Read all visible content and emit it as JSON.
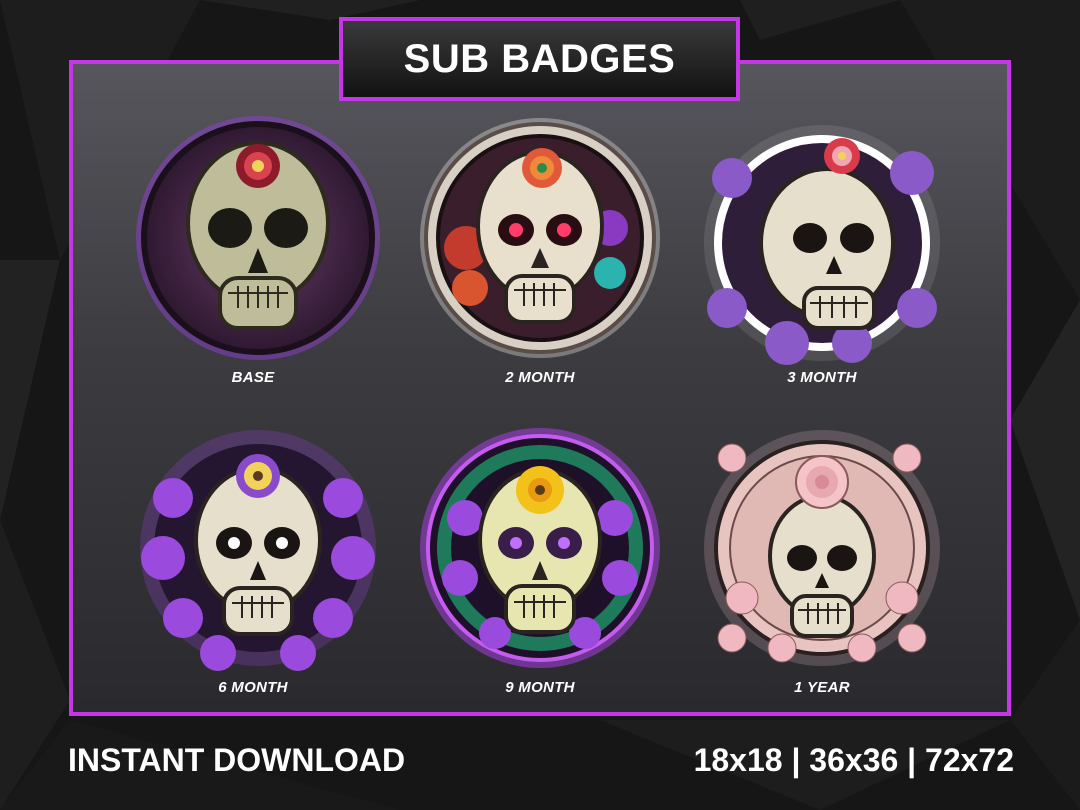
{
  "header": {
    "title": "SUB BADGES"
  },
  "badges": [
    {
      "label": "BASE"
    },
    {
      "label": "2 MONTH"
    },
    {
      "label": "3 MONTH"
    },
    {
      "label": "6 MONTH"
    },
    {
      "label": "9 MONTH"
    },
    {
      "label": "1 YEAR"
    }
  ],
  "footer": {
    "left": "INSTANT DOWNLOAD",
    "right": "18x18 | 36x36 | 72x72"
  },
  "colors": {
    "accent": "#c436e6",
    "background": "#141414",
    "panel": "#3b3b40",
    "text": "#ffffff"
  }
}
